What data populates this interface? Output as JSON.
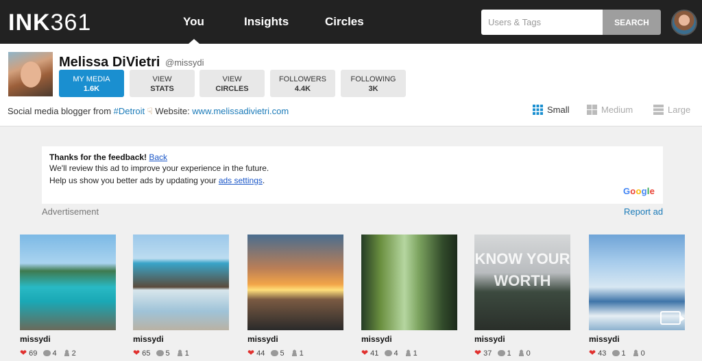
{
  "nav": {
    "logo_bold": "INK",
    "logo_thin": "361",
    "items": [
      "You",
      "Insights",
      "Circles"
    ],
    "search_placeholder": "Users & Tags",
    "search_button": "SEARCH"
  },
  "profile": {
    "name": "Melissa DiVietri",
    "handle": "@missydi",
    "stats": [
      {
        "label": "MY MEDIA",
        "value": "1.6K"
      },
      {
        "label": "VIEW",
        "value": "STATS"
      },
      {
        "label": "VIEW",
        "value": "CIRCLES"
      },
      {
        "label": "FOLLOWERS",
        "value": "4.4K"
      },
      {
        "label": "FOLLOWING",
        "value": "3K"
      }
    ],
    "bio_prefix": "Social media blogger from ",
    "bio_tag": "#Detroit",
    "bio_website_label": "Website: ",
    "bio_website": "www.melissadivietri.com",
    "view_sizes": [
      "Small",
      "Medium",
      "Large"
    ]
  },
  "ad": {
    "title": "Thanks for the feedback!",
    "back": "Back",
    "line1": "We'll review this ad to improve your experience in the future.",
    "line2_prefix": "Help us show you better ads by updating your ",
    "line2_link": "ads settings",
    "line2_suffix": ".",
    "google": "Google",
    "label": "Advertisement",
    "report": "Report ad"
  },
  "photos": [
    {
      "user": "missydi",
      "likes": "69",
      "comments": "4",
      "tags": "2"
    },
    {
      "user": "missydi",
      "likes": "65",
      "comments": "5",
      "tags": "1"
    },
    {
      "user": "missydi",
      "likes": "44",
      "comments": "5",
      "tags": "1"
    },
    {
      "user": "missydi",
      "likes": "41",
      "comments": "4",
      "tags": "1"
    },
    {
      "user": "missydi",
      "likes": "37",
      "comments": "1",
      "tags": "0",
      "overlay": "KNOW YOUR WORTH"
    },
    {
      "user": "missydi",
      "likes": "43",
      "comments": "1",
      "tags": "0"
    }
  ]
}
